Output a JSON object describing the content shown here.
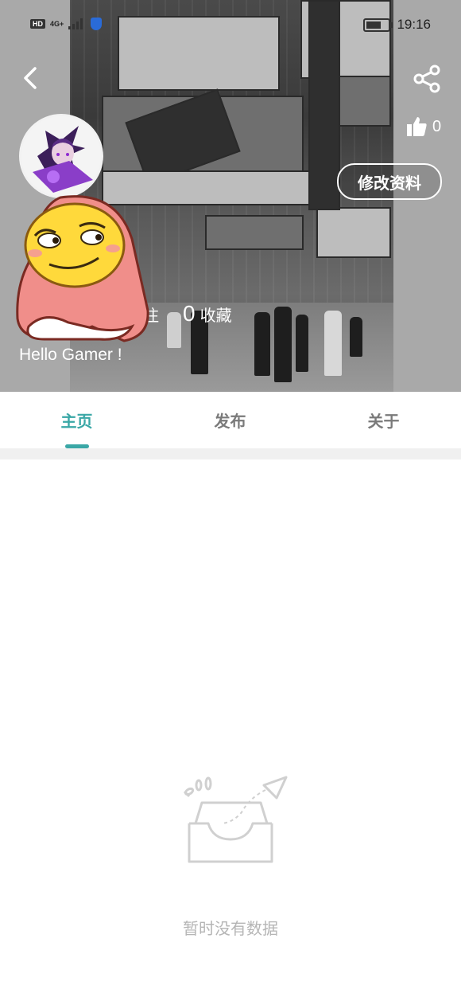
{
  "status_bar": {
    "hd": "HD",
    "network": "4G+",
    "time": "19:16"
  },
  "header": {
    "like_count": "0",
    "edit_profile_label": "修改资料",
    "stats": {
      "follow_label_partial": "注",
      "favorites_count": "0",
      "favorites_label": "收藏"
    },
    "bio": "Hello Gamer !"
  },
  "tabs": [
    {
      "label": "主页",
      "active": true
    },
    {
      "label": "发布",
      "active": false
    },
    {
      "label": "关于",
      "active": false
    }
  ],
  "empty_state": {
    "message": "暂时没有数据"
  },
  "colors": {
    "accent": "#3aa7a6",
    "header_bg": "#a9a9a9",
    "empty_text": "#b5b5b5"
  },
  "icons": [
    "back-arrow-icon",
    "share-icon",
    "thumbs-up-icon",
    "empty-inbox-icon"
  ]
}
